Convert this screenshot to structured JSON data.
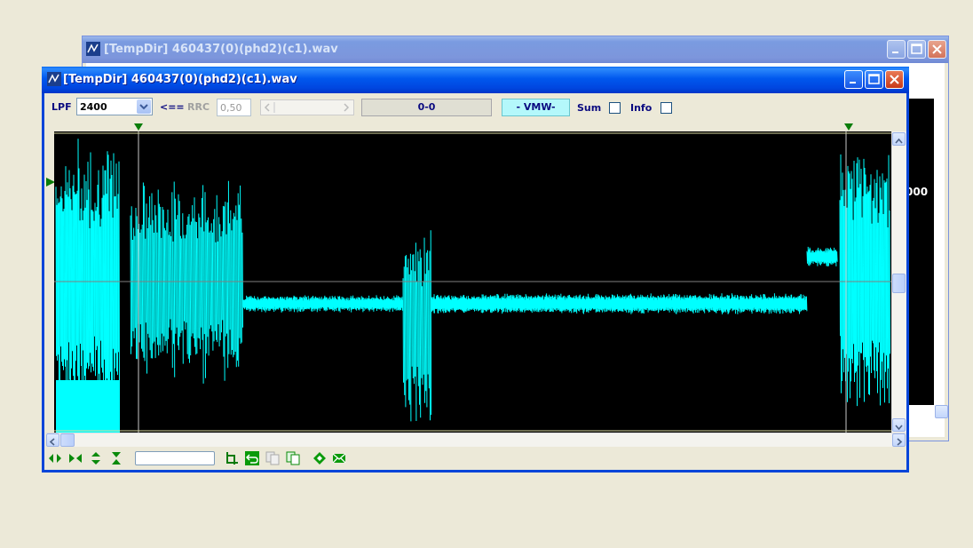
{
  "back_window": {
    "title": "[TempDir] 460437(0)(phd2)(c1).wav",
    "partial_text": "000"
  },
  "front_window": {
    "title": "[TempDir] 460437(0)(phd2)(c1).wav",
    "toolbar": {
      "lpf_label": "LPF",
      "lpf_value": "2400",
      "arrow_label": "<==",
      "rrc_label": "RRC",
      "rrc_value": "0,50",
      "range_value": "0-0",
      "mode_value": "- VMW-",
      "sum_label": "Sum",
      "info_label": "Info"
    },
    "icons": {
      "app": "app-icon",
      "minimize": "minimize-icon",
      "maximize": "maximize-icon",
      "close": "close-icon"
    },
    "colors": {
      "waveform": "#00ffff",
      "background": "#000000",
      "marker": "#006400",
      "baseline": "#808080"
    }
  }
}
